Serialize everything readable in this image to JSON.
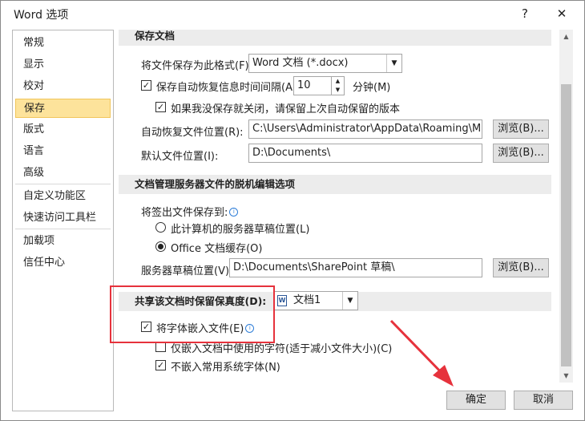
{
  "window": {
    "title": "Word 选项",
    "help": "?",
    "close": "✕"
  },
  "sidebar": {
    "items": [
      {
        "label": "常规"
      },
      {
        "label": "显示"
      },
      {
        "label": "校对"
      },
      {
        "label": "保存"
      },
      {
        "label": "版式"
      },
      {
        "label": "语言"
      },
      {
        "label": "高级"
      },
      {
        "label": "自定义功能区"
      },
      {
        "label": "快速访问工具栏"
      },
      {
        "label": "加载项"
      },
      {
        "label": "信任中心"
      }
    ],
    "active": "保存"
  },
  "save_docs": {
    "header": "保存文档",
    "format_label": "将文件保存为此格式(F):",
    "format_value": "Word 文档 (*.docx)",
    "autorecover_label": "保存自动恢复信息时间间隔(A)",
    "autorecover_checked": true,
    "autorecover_minutes": "10",
    "minutes_unit": "分钟(M)",
    "keep_last_label": "如果我没保存就关闭，请保留上次自动保留的版本",
    "keep_last_checked": true,
    "autorecover_location_label": "自动恢复文件位置(R):",
    "autorecover_location_value": "C:\\Users\\Administrator\\AppData\\Roaming\\Micro",
    "default_location_label": "默认文件位置(I):",
    "default_location_value": "D:\\Documents\\",
    "browse": "浏览(B)..."
  },
  "offline": {
    "header": "文档管理服务器文件的脱机编辑选项",
    "saveto_label": "将签出文件保存到:",
    "option_server": "此计算机的服务器草稿位置(L)",
    "option_office": "Office 文档缓存(O)",
    "selected": "Office 文档缓存(O)",
    "drafts_label": "服务器草稿位置(V):",
    "drafts_value": "D:\\Documents\\SharePoint 草稿\\",
    "browse": "浏览(B)..."
  },
  "fidelity": {
    "header": "共享该文档时保留保真度(D):",
    "doc_value": "文档1",
    "embed_fonts_label": "将字体嵌入文件(E)",
    "embed_fonts_checked": true,
    "embed_used_only_label": "仅嵌入文档中使用的字符(适于减小文件大小)(C)",
    "embed_used_only_checked": false,
    "no_common_label": "不嵌入常用系统字体(N)",
    "no_common_checked": true
  },
  "footer": {
    "ok": "确定",
    "cancel": "取消"
  },
  "colors": {
    "accent_selected": "#fde39b",
    "annotation_red": "#e6323c"
  }
}
